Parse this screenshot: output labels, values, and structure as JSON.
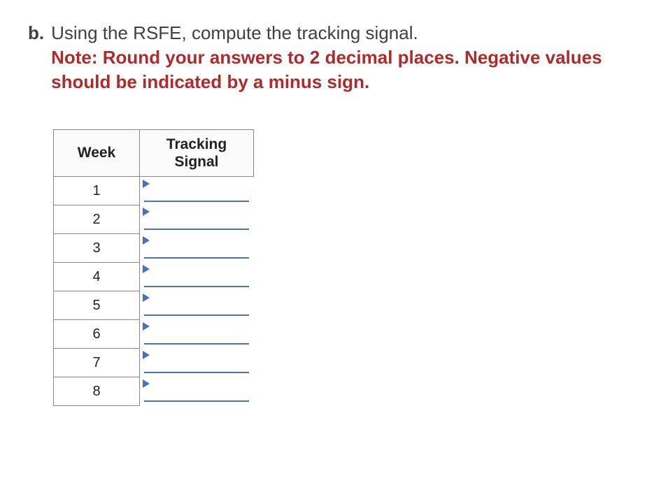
{
  "question": {
    "number": "b.",
    "text": "Using the RSFE, compute the tracking signal.",
    "note": "Note: Round your answers to 2 decimal places. Negative values should be indicated by a minus sign."
  },
  "table": {
    "headers": {
      "week": "Week",
      "tracking": "Tracking\nSignal"
    },
    "rows": [
      {
        "week": "1",
        "signal": ""
      },
      {
        "week": "2",
        "signal": ""
      },
      {
        "week": "3",
        "signal": ""
      },
      {
        "week": "4",
        "signal": ""
      },
      {
        "week": "5",
        "signal": ""
      },
      {
        "week": "6",
        "signal": ""
      },
      {
        "week": "7",
        "signal": ""
      },
      {
        "week": "8",
        "signal": ""
      }
    ]
  }
}
